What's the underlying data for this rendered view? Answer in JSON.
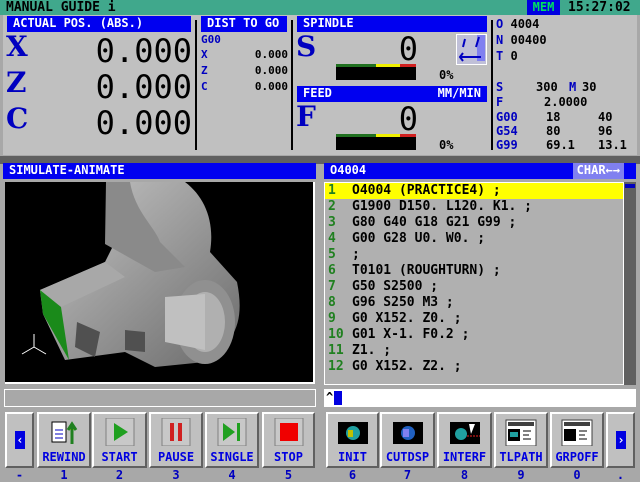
{
  "title": "MANUAL GUIDE i",
  "mode": "MEM",
  "clock": "15:27:02",
  "colors": {
    "title_bg": "#40a88c",
    "header_bg": "#0000f0",
    "axis_label": "#0000c0",
    "highlight": "#ffff00",
    "line_num": "#208020"
  },
  "actual_pos": {
    "header": "ACTUAL POS. (ABS.)",
    "axes": [
      {
        "name": "X",
        "value": "0.000"
      },
      {
        "name": "Z",
        "value": "0.000"
      },
      {
        "name": "C",
        "value": "0.000"
      }
    ]
  },
  "dist_to_go": {
    "header": "DIST TO GO",
    "gcode": "G00",
    "axes": [
      {
        "name": "X",
        "value": "0.000"
      },
      {
        "name": "Z",
        "value": "0.000"
      },
      {
        "name": "C",
        "value": "0.000"
      }
    ]
  },
  "spindle": {
    "header": "SPINDLE",
    "letter": "S",
    "value": "0",
    "load": "0%",
    "load_fraction": 0
  },
  "feed": {
    "header": "FEED",
    "unit": "MM/MIN",
    "letter": "F",
    "value": "0",
    "load": "0%",
    "load_fraction": 0
  },
  "info": {
    "O": "4004",
    "N": "00400",
    "T": "0",
    "S": "300",
    "M": "30",
    "F": "2.0000",
    "modal": [
      [
        "G00",
        "18",
        "40"
      ],
      [
        "G54",
        "80",
        "96"
      ],
      [
        "G99",
        "69.1",
        "13.1"
      ]
    ]
  },
  "simulation": {
    "header": "SIMULATE-ANIMATE"
  },
  "program": {
    "header": "O4004",
    "mode": "CHAR←→",
    "input_prompt": "^",
    "lines": [
      {
        "n": "1",
        "text": "O4004 (PRACTICE4) ;"
      },
      {
        "n": "2",
        "text": "G1900 D150. L120. K1. ;"
      },
      {
        "n": "3",
        "text": "G80 G40 G18 G21 G99 ;"
      },
      {
        "n": "4",
        "text": "G00 G28 U0. W0. ;"
      },
      {
        "n": "5",
        "text": ";"
      },
      {
        "n": "6",
        "text": "T0101 (ROUGHTURN) ;"
      },
      {
        "n": "7",
        "text": "G50 S2500 ;"
      },
      {
        "n": "8",
        "text": "G96 S250 M3 ;"
      },
      {
        "n": "9",
        "text": "G0 X152. Z0. ;"
      },
      {
        "n": "10",
        "text": "G01 X-1. F0.2 ;"
      },
      {
        "n": "11",
        "text": "Z1. ;"
      },
      {
        "n": "12",
        "text": "G0 X152. Z2. ;"
      }
    ]
  },
  "softkeys": {
    "left_arrow": "‹",
    "right_arrow": "›",
    "left_num": "-",
    "right_num": ".",
    "keys": [
      {
        "label": "REWIND",
        "num": "1",
        "icon": "rewind-icon"
      },
      {
        "label": "START",
        "num": "2",
        "icon": "play-icon"
      },
      {
        "label": "PAUSE",
        "num": "3",
        "icon": "pause-icon"
      },
      {
        "label": "SINGLE",
        "num": "4",
        "icon": "single-step-icon"
      },
      {
        "label": "STOP",
        "num": "5",
        "icon": "stop-icon"
      },
      {
        "label": "INIT",
        "num": "6",
        "icon": "init-icon"
      },
      {
        "label": "CUTDSP",
        "num": "7",
        "icon": "cut-display-icon"
      },
      {
        "label": "INTERF",
        "num": "8",
        "icon": "interference-icon"
      },
      {
        "label": "TLPATH",
        "num": "9",
        "icon": "tool-path-icon"
      },
      {
        "label": "GRPOFF",
        "num": "0",
        "icon": "graphic-off-icon"
      }
    ]
  }
}
